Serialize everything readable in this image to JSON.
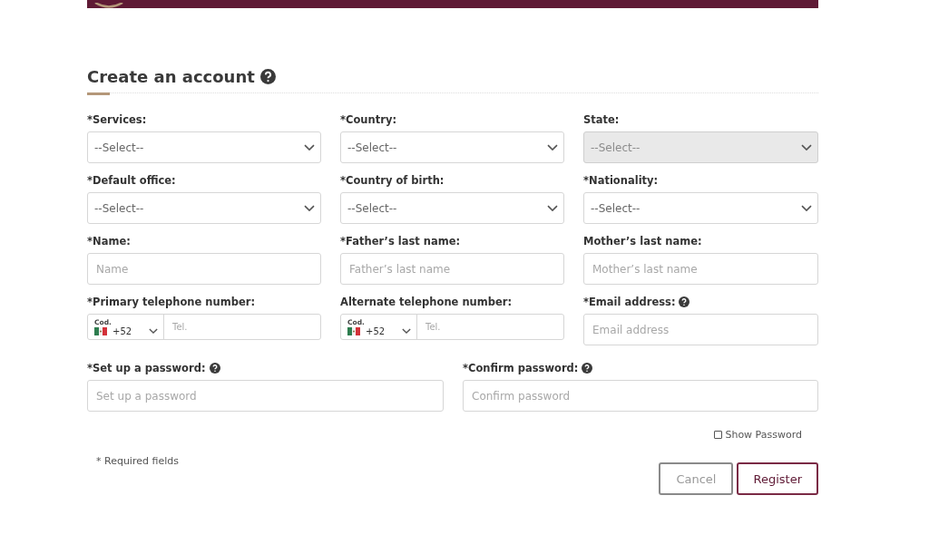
{
  "title": "Create an account",
  "fields": [
    {
      "label": "*Services:",
      "kind": "select",
      "placeholder": "--Select--",
      "disabled": false
    },
    {
      "label": "*Country:",
      "kind": "select",
      "placeholder": "--Select--",
      "disabled": false
    },
    {
      "label": "State:",
      "kind": "select",
      "placeholder": "--Select--",
      "disabled": true
    },
    {
      "label": "*Default office:",
      "kind": "select",
      "placeholder": "--Select--",
      "disabled": false
    },
    {
      "label": "*Country of birth:",
      "kind": "select",
      "placeholder": "--Select--",
      "disabled": false
    },
    {
      "label": "*Nationality:",
      "kind": "select",
      "placeholder": "--Select--",
      "disabled": false
    },
    {
      "label": "*Name:",
      "kind": "text",
      "placeholder": "Name"
    },
    {
      "label": "*Father’s last name:",
      "kind": "text",
      "placeholder": "Father’s last name"
    },
    {
      "label": "Mother’s last name:",
      "kind": "text",
      "placeholder": "Mother’s last name"
    },
    {
      "label": "*Primary telephone number:",
      "kind": "phone",
      "code_label": "Cod.",
      "code": "+52",
      "placeholder": "Tel."
    },
    {
      "label": "Alternate telephone number:",
      "kind": "phone",
      "code_label": "Cod.",
      "code": "+52",
      "placeholder": "Tel."
    },
    {
      "label": "*Email address:",
      "kind": "text",
      "placeholder": "Email address",
      "help": true
    }
  ],
  "password_fields": [
    {
      "label": "*Set up a password:",
      "placeholder": "Set up a password",
      "help": true
    },
    {
      "label": "*Confirm password:",
      "placeholder": "Confirm password",
      "help": true
    }
  ],
  "show_password": {
    "label": "Show Password",
    "checked": false
  },
  "required_note": "* Required fields",
  "buttons": [
    {
      "label": "Cancel",
      "kind": "secondary"
    },
    {
      "label": "Register",
      "kind": "primary"
    }
  ]
}
